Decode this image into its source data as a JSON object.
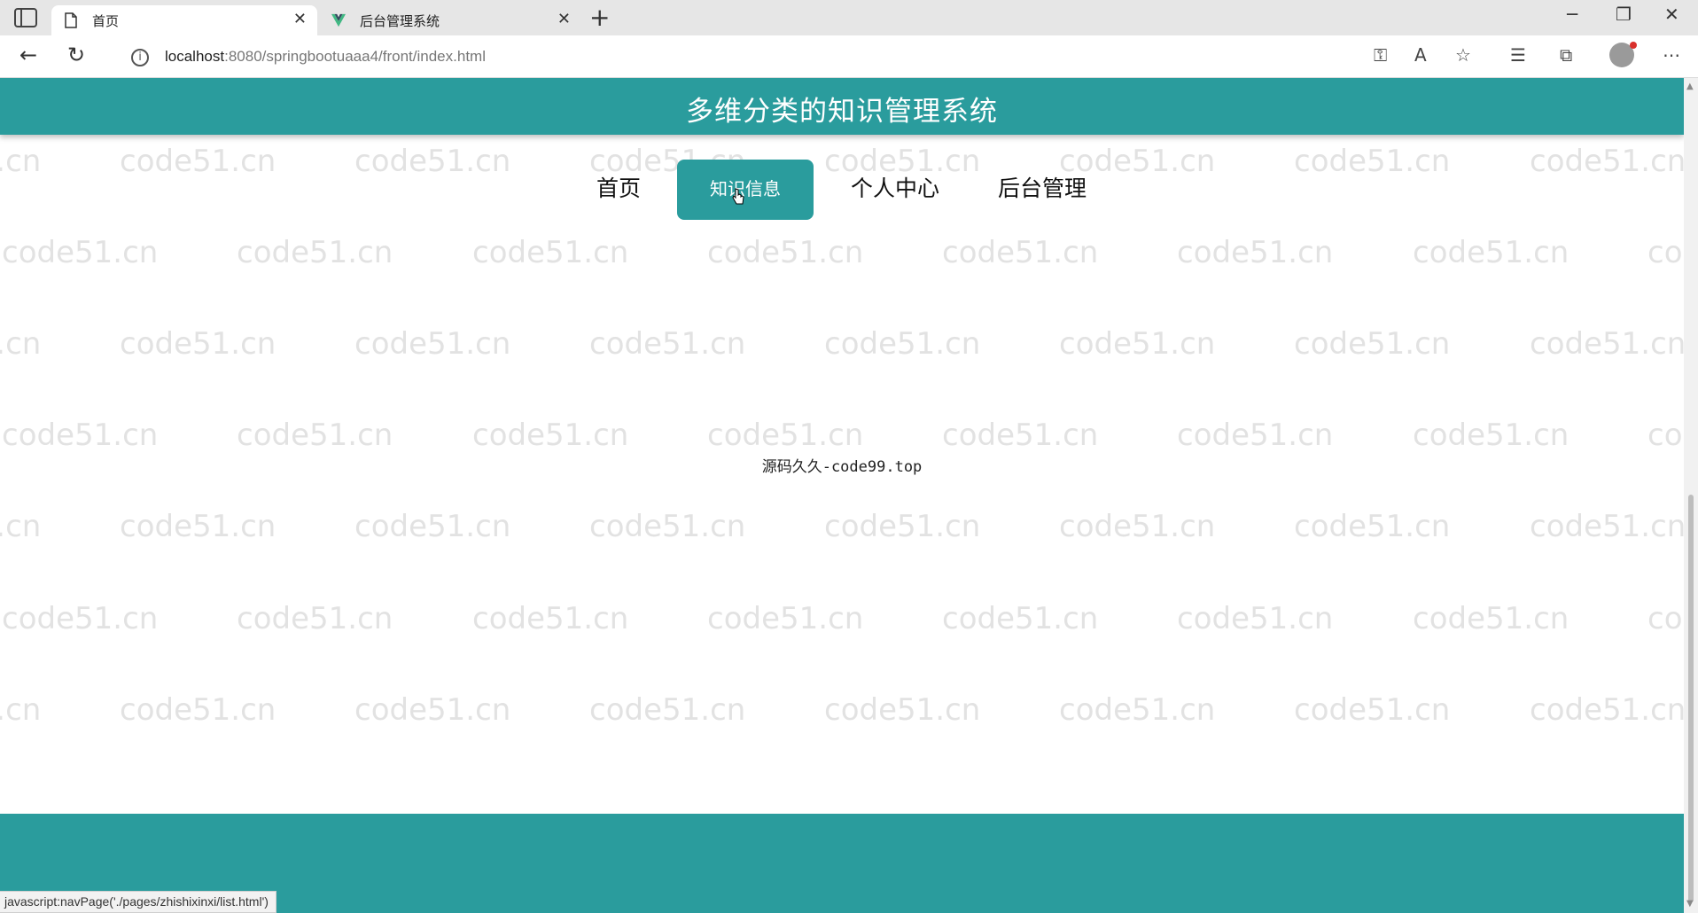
{
  "browser": {
    "tabs": [
      {
        "title": "首页",
        "active": true
      },
      {
        "title": "后台管理系统",
        "active": false
      }
    ],
    "url_host": "localhost",
    "url_rest": ":8080/springbootuaaa4/front/index.html",
    "status_text": "javascript:navPage('./pages/zhishixinxi/list.html')",
    "icons": {
      "tab_actions": "tab-actions-icon",
      "page": "page-icon",
      "vue": "vue-logo-icon",
      "close": "close-icon",
      "new_tab": "plus-icon",
      "back": "back-arrow-icon",
      "refresh": "refresh-icon",
      "info": "info-icon",
      "key": "key-icon",
      "read_aloud": "read-aloud-icon",
      "favorite_add": "star-add-icon",
      "favorites": "favorites-icon",
      "collections": "collections-icon",
      "profile": "profile-icon",
      "more": "more-icon"
    }
  },
  "site": {
    "title": "多维分类的知识管理系统",
    "nav": [
      {
        "label": "首页",
        "active": false
      },
      {
        "label": "知识信息",
        "active": true
      },
      {
        "label": "个人中心",
        "active": false
      },
      {
        "label": "后台管理",
        "active": false
      }
    ],
    "footer_text": "源码久久-code99.top",
    "watermark": "code51.cn"
  },
  "colors": {
    "primary": "#2a9c9d",
    "header_text": "#ffffff",
    "nav_text": "#111111"
  }
}
